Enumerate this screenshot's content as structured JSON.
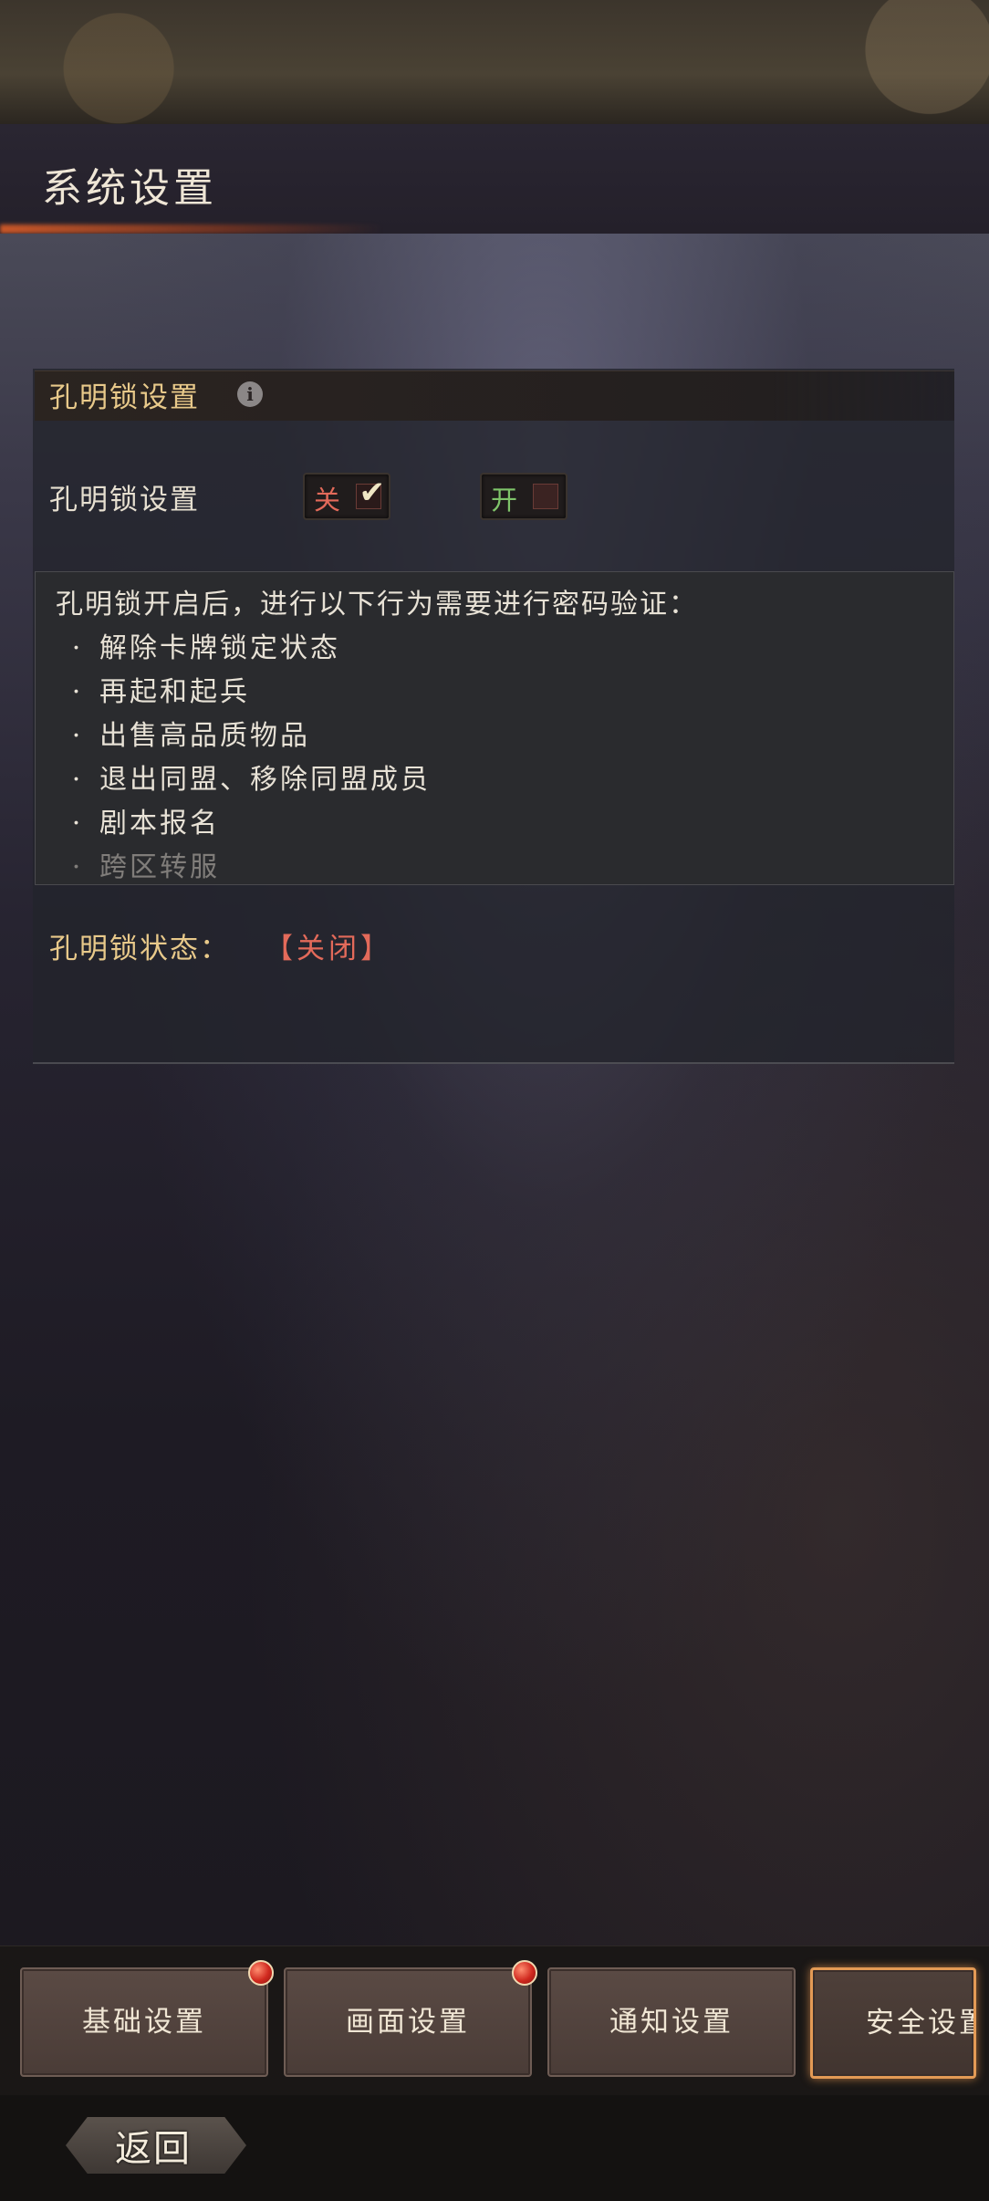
{
  "header": {
    "title": "系统设置"
  },
  "section": {
    "title": "孔明锁设置",
    "info_icon": "info-icon",
    "row_label": "孔明锁设置",
    "toggle_off_label": "关",
    "toggle_on_label": "开",
    "selected": "关"
  },
  "description": {
    "intro": "孔明锁开启后，进行以下行为需要进行密码验证：",
    "items": [
      "解除卡牌锁定状态",
      "再起和起兵",
      "出售高品质物品",
      "退出同盟、移除同盟成员",
      "剧本报名",
      "跨区转服"
    ]
  },
  "status": {
    "label": "孔明锁状态：",
    "value": "【关闭】"
  },
  "tabs": [
    {
      "label": "基础设置",
      "badge": true
    },
    {
      "label": "画面设置",
      "badge": true
    },
    {
      "label": "通知设置",
      "badge": false
    },
    {
      "label": "安全设置",
      "badge": false,
      "active": true
    }
  ],
  "footer": {
    "back_label": "返回"
  },
  "colors": {
    "accent": "#e8c98a",
    "status_closed": "#e36a5a",
    "active_tab_border": "#e39a55"
  }
}
